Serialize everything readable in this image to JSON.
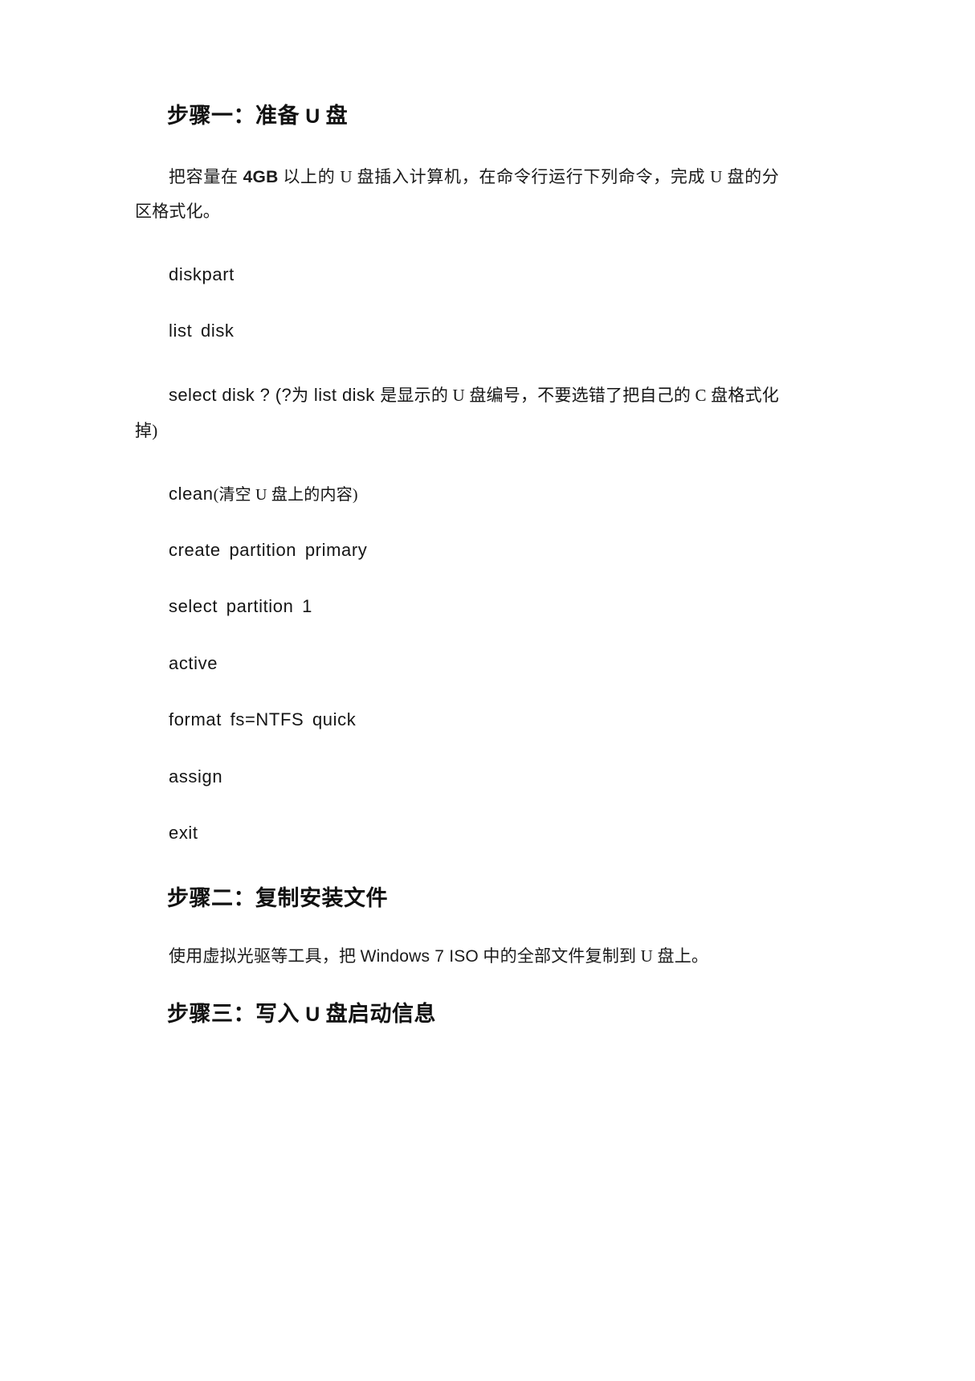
{
  "document": {
    "language": "zh-CN",
    "background_color": "#ffffff",
    "text_color": "#1a1a1a"
  },
  "sections": [
    {
      "heading_prefix": "步骤一：准备 ",
      "heading_emphasis": "U",
      "heading_suffix": " 盘",
      "intro": {
        "lead": "把容量在 ",
        "emphasis": "4GB",
        "rest": " 以上的 U 盘插入计算机，在命令行运行下列命令，完成 U 盘的分区格式化。"
      }
    }
  ],
  "headings": {
    "step1_prefix": "步骤一：准备 ",
    "step1_u": "U",
    "step1_suffix": " 盘",
    "step2": "步骤二：复制安装文件",
    "step3_prefix": "步骤三：写入 ",
    "step3_u": "U",
    "step3_suffix": " 盘启动信息"
  },
  "paragraphs": {
    "intro_lead": "把容量在 ",
    "intro_bold": "4GB",
    "intro_rest": " 以上的 U 盘插入计算机，在命令行运行下列命令，完成 U 盘的分区格式化。",
    "step2_body_a": "使用虚拟光驱等工具，把 ",
    "step2_body_latin": "Windows 7 ISO",
    "step2_body_b": " 中的全部文件复制到 U 盘上。"
  },
  "commands": [
    {
      "id": "cmd-diskpart",
      "text": "diskpart",
      "note": ""
    },
    {
      "id": "cmd-list-disk",
      "text": "list disk",
      "note": ""
    },
    {
      "id": "cmd-select-disk",
      "text": "select disk ? (?",
      "note": "为 list disk 是显示的 U 盘编号，不要选错了把自己的 C 盘格式化掉)",
      "note_latin": "list disk",
      "wrapping": true
    },
    {
      "id": "cmd-clean",
      "text": "clean",
      "note": "(清空 U 盘上的内容)"
    },
    {
      "id": "cmd-create-partition",
      "text": "create partition primary",
      "note": ""
    },
    {
      "id": "cmd-select-partition",
      "text": "select partition 1",
      "note": ""
    },
    {
      "id": "cmd-active",
      "text": "active",
      "note": ""
    },
    {
      "id": "cmd-format",
      "text": "format fs=NTFS quick",
      "note": ""
    },
    {
      "id": "cmd-assign",
      "text": "assign",
      "note": ""
    },
    {
      "id": "cmd-exit",
      "text": "exit",
      "note": ""
    }
  ],
  "select_disk_line": {
    "part1": "select disk ? (?",
    "cjk1": "为",
    "part2": " list disk ",
    "cjk2": "是显示的 U 盘编号，不要选错了把自己的 C 盘格式化掉)"
  },
  "clean_line": {
    "command": "clean",
    "note": "(清空 U 盘上的内容)"
  }
}
